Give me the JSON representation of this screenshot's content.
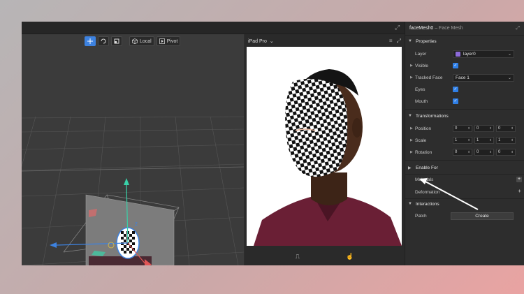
{
  "viewport_toolbar": {
    "local_label": "Local",
    "pivot_label": "Pivot"
  },
  "preview": {
    "device": "iPad Pro"
  },
  "panel": {
    "object_name": "faceMesh0",
    "object_type": "– Face Mesh",
    "sections": {
      "properties": "Properties",
      "transformations": "Transformations",
      "enable_for": "Enable For",
      "interactions": "Interactions"
    },
    "properties": {
      "layer_label": "Layer",
      "layer_value": "layer0",
      "visible_label": "Visible",
      "tracked_face_label": "Tracked Face",
      "tracked_face_value": "Face 1",
      "eyes_label": "Eyes",
      "mouth_label": "Mouth"
    },
    "transformations": {
      "position_label": "Position",
      "position": [
        "0",
        "0",
        "0"
      ],
      "scale_label": "Scale",
      "scale": [
        "1",
        "1",
        "1"
      ],
      "rotation_label": "Rotation",
      "rotation": [
        "0",
        "0",
        "0"
      ]
    },
    "materials_label": "Materials",
    "deformation_label": "Deformation",
    "patch_label": "Patch",
    "create_label": "Create"
  },
  "colors": {
    "accent": "#3d82e0",
    "layer_swatch": "#8c6ad9"
  }
}
